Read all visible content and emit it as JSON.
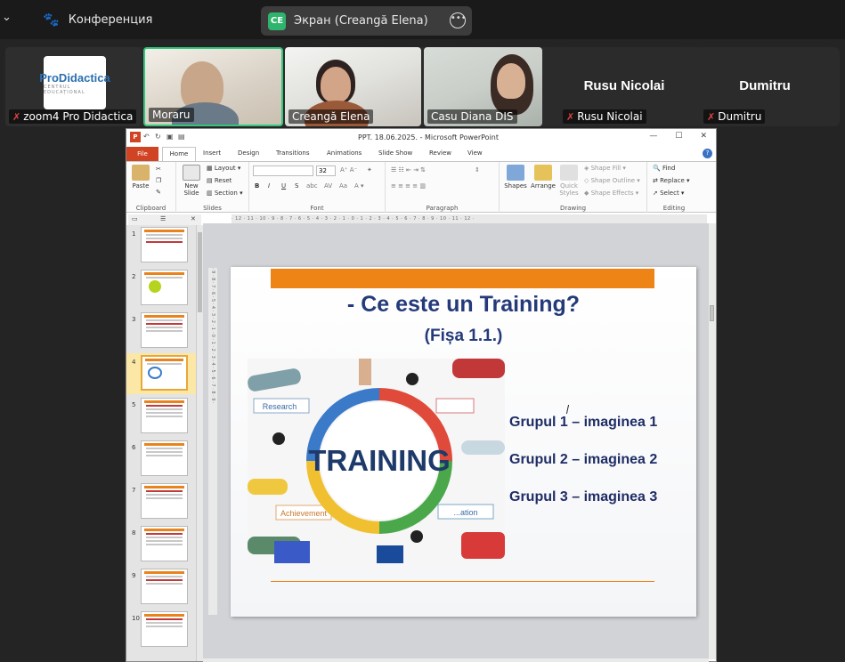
{
  "zoom": {
    "conference_label": "Конференция",
    "screen_share": {
      "badge": "CE",
      "label": "Экран (Creangă Elena)"
    },
    "participants": [
      {
        "name": "zoom4 Pro Didactica",
        "muted": true,
        "logo": "ProDidactica",
        "logo_sub": "CENTRUL EDUCAȚIONAL"
      },
      {
        "name": "Moraru",
        "muted": false
      },
      {
        "name": "Creangă Elena",
        "muted": false
      },
      {
        "name": "Casu Diana DIS",
        "muted": false
      },
      {
        "name": "Rusu Nicolai",
        "muted": true,
        "big_name": "Rusu Nicolai"
      },
      {
        "name": "Dumitru",
        "muted": true,
        "big_name": "Dumitru"
      }
    ]
  },
  "ppt": {
    "window_title": "PPT. 18.06.2025. - Microsoft PowerPoint",
    "tabs": [
      "File",
      "Home",
      "Insert",
      "Design",
      "Transitions",
      "Animations",
      "Slide Show",
      "Review",
      "View"
    ],
    "ribbon": {
      "clipboard": {
        "paste": "Paste",
        "label": "Clipboard"
      },
      "slides": {
        "new_slide": "New Slide",
        "layout": "Layout",
        "reset": "Reset",
        "section": "Section",
        "label": "Slides"
      },
      "font": {
        "size": "32",
        "label": "Font"
      },
      "paragraph": {
        "label": "Paragraph"
      },
      "drawing": {
        "shapes": "Shapes",
        "arrange": "Arrange",
        "quick_styles": "Quick Styles",
        "shape_fill": "Shape Fill",
        "shape_outline": "Shape Outline",
        "shape_effects": "Shape Effects",
        "label": "Drawing"
      },
      "editing": {
        "find": "Find",
        "replace": "Replace",
        "select": "Select",
        "label": "Editing"
      }
    },
    "slide_numbers": [
      "1",
      "2",
      "3",
      "4",
      "5",
      "6",
      "7",
      "8",
      "9",
      "10"
    ],
    "selected_slide": 4,
    "slide": {
      "title": "- Ce este un Training?",
      "subtitle": "(Fișa 1.1.)",
      "image_word": "TRAINING",
      "image_tags": [
        "Research",
        "Achievement",
        "...ation"
      ],
      "groups": [
        "Grupul 1 – imaginea 1",
        "Grupul 2 – imaginea 2",
        "Grupul 3 – imaginea 3"
      ]
    }
  }
}
